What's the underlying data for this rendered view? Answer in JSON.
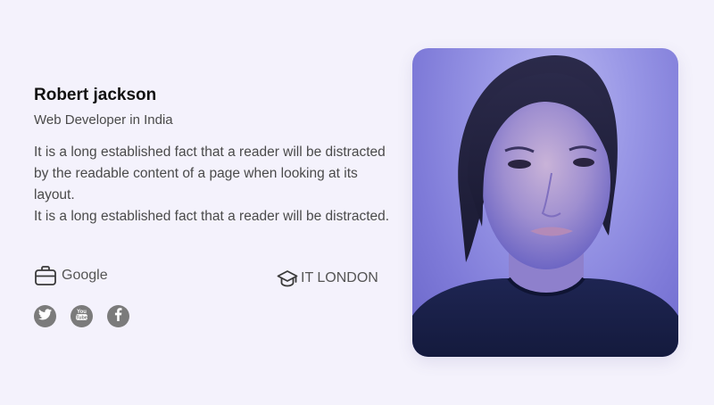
{
  "profile": {
    "name": "Robert jackson",
    "role": "Web Developer in India",
    "bio": [
      "It is a long established fact that a reader will be distracted by the readable content of a page when looking at its layout.",
      "It is a long established fact that a reader will be distracted."
    ],
    "company": "Google",
    "school": "IT LONDON"
  },
  "socials": [
    "twitter-icon",
    "youtube-icon",
    "facebook-icon"
  ],
  "colors": {
    "background": "#f4f2fc",
    "social_icon_bg": "#7b7b7b",
    "photo_bg": "#9997e6"
  }
}
